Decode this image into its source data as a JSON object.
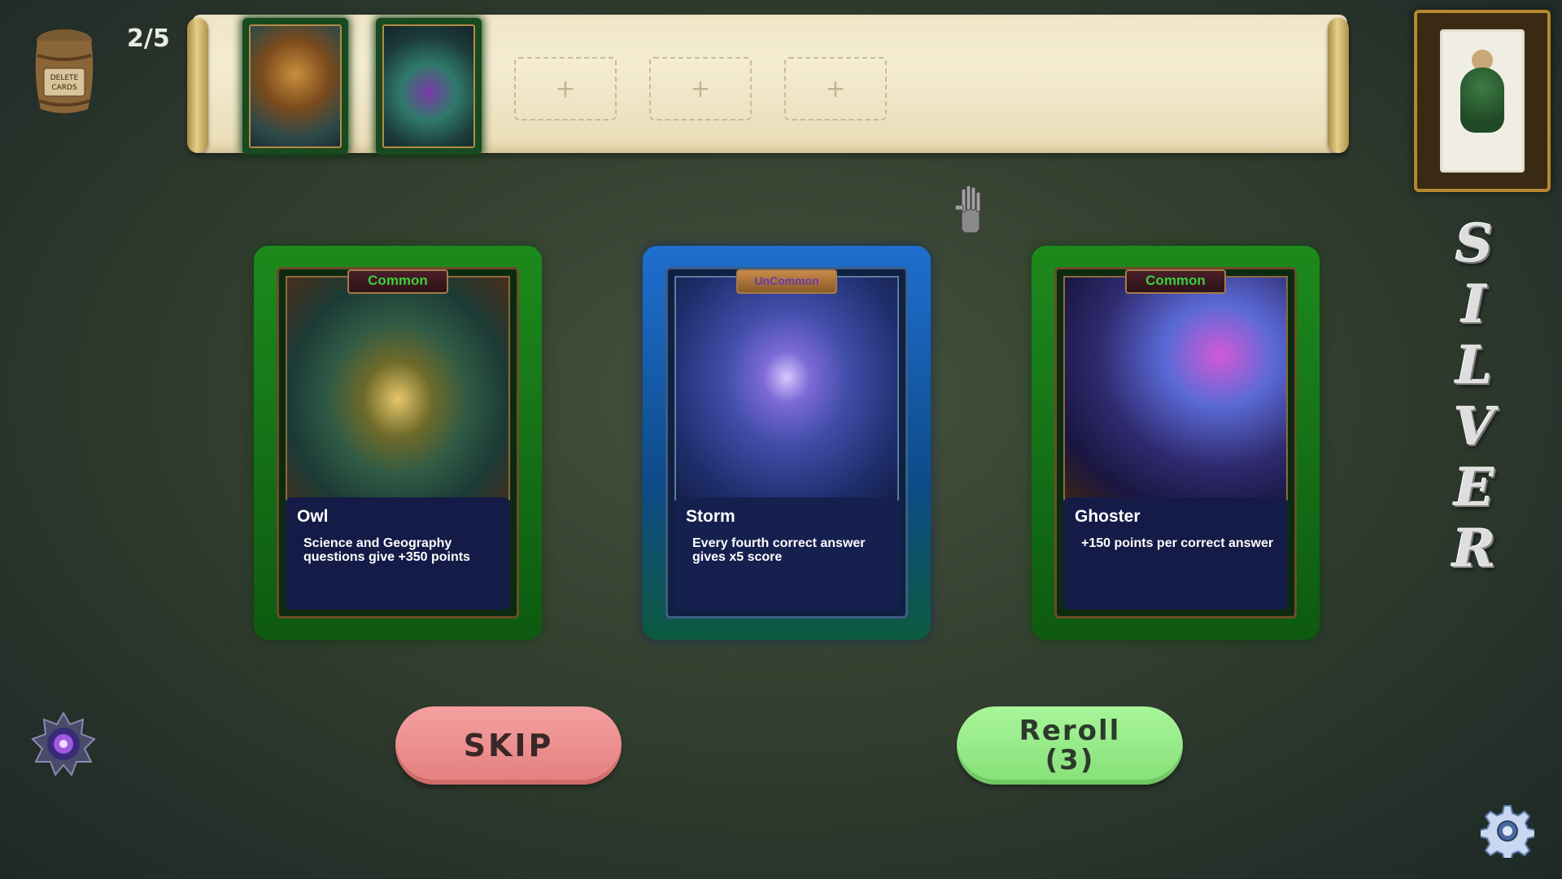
{
  "hud": {
    "barrel_label": "DELETE CARDS",
    "deck_count": "2/5"
  },
  "deck_bar": {
    "slots": [
      "+",
      "+",
      "+"
    ]
  },
  "boss": {
    "title": "SILVER",
    "letters": [
      "S",
      "I",
      "L",
      "V",
      "E",
      "R"
    ]
  },
  "cards": [
    {
      "rarity": "Common",
      "name": "Owl",
      "description": "Science and Geography questions give +350 points"
    },
    {
      "rarity": "UnCommon",
      "name": "Storm",
      "description": "Every fourth correct answer gives x5 score"
    },
    {
      "rarity": "Common",
      "name": "Ghoster",
      "description": "+150 points per correct answer"
    }
  ],
  "actions": {
    "skip_label": "SKIP",
    "reroll_label": "Reroll",
    "reroll_count": "(3)"
  },
  "colors": {
    "common": "#3dcf3d",
    "uncommon": "#6a3aa8",
    "skip": "#ec8f8f",
    "reroll": "#95ea87"
  }
}
